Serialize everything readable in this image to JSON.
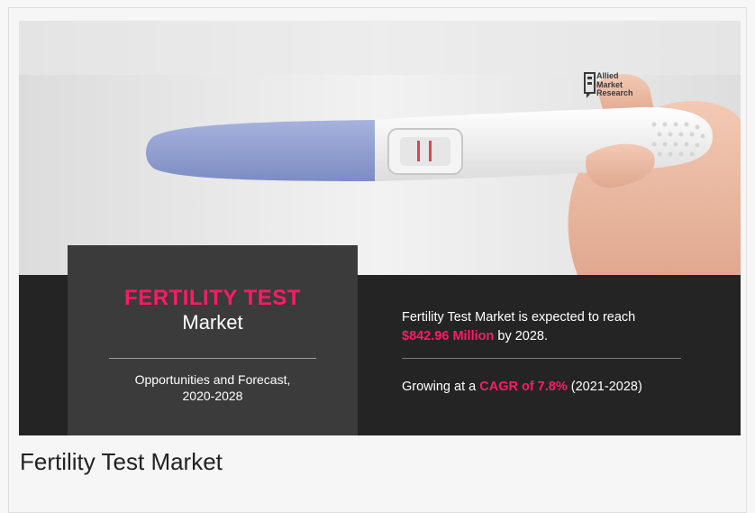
{
  "banner": {
    "logo": {
      "line1": "Allied",
      "line2": "Market",
      "line3": "Research"
    },
    "left_panel": {
      "title": "FERTILITY TEST",
      "subtitle": "Market",
      "desc_line1": "Opportunities and Forecast,",
      "desc_line2": "2020-2028"
    },
    "right_panel": {
      "line1": "Fertility Test Market is expected to reach",
      "highlight_value": "$842.96 Million",
      "line2_rest": " by 2028.",
      "line3_prefix": "Growing at a ",
      "highlight_cagr": "CAGR of 7.8%",
      "line3_suffix": " (2021-2028)"
    },
    "colors": {
      "accent": "#ff1a66",
      "dark": "#242424",
      "panel": "#3b3b3b"
    }
  },
  "caption": "Fertility Test Market"
}
